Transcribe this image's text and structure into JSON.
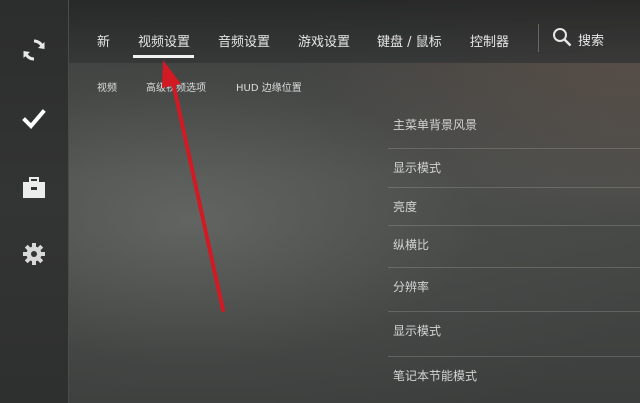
{
  "sidebar": {
    "items": [
      {
        "icon": "refresh-icon"
      },
      {
        "icon": "check-icon"
      },
      {
        "icon": "briefcase-icon"
      },
      {
        "icon": "gear-icon"
      }
    ]
  },
  "topnav": {
    "tabs": [
      {
        "label": "新"
      },
      {
        "label": "视频设置"
      },
      {
        "label": "音频设置"
      },
      {
        "label": "游戏设置"
      },
      {
        "label": "键盘 / 鼠标"
      },
      {
        "label": "控制器"
      }
    ],
    "active_tab": "视频设置",
    "search_label": "搜索",
    "search_icon": "search-icon"
  },
  "subnav": {
    "tabs": [
      {
        "label": "视频"
      },
      {
        "label": "高级视频选项"
      },
      {
        "label": "HUD 边缘位置"
      }
    ]
  },
  "settings": {
    "rows": [
      {
        "label": "主菜单背景风景"
      },
      {
        "label": "显示模式"
      },
      {
        "label": "亮度"
      },
      {
        "label": "纵横比"
      },
      {
        "label": "分辨率"
      },
      {
        "label": "显示模式"
      },
      {
        "label": "笔记本节能模式"
      }
    ]
  },
  "colors": {
    "accent": "#f2f2f2",
    "annotation_arrow": "#d11a24",
    "text": "#e6e6e6"
  }
}
